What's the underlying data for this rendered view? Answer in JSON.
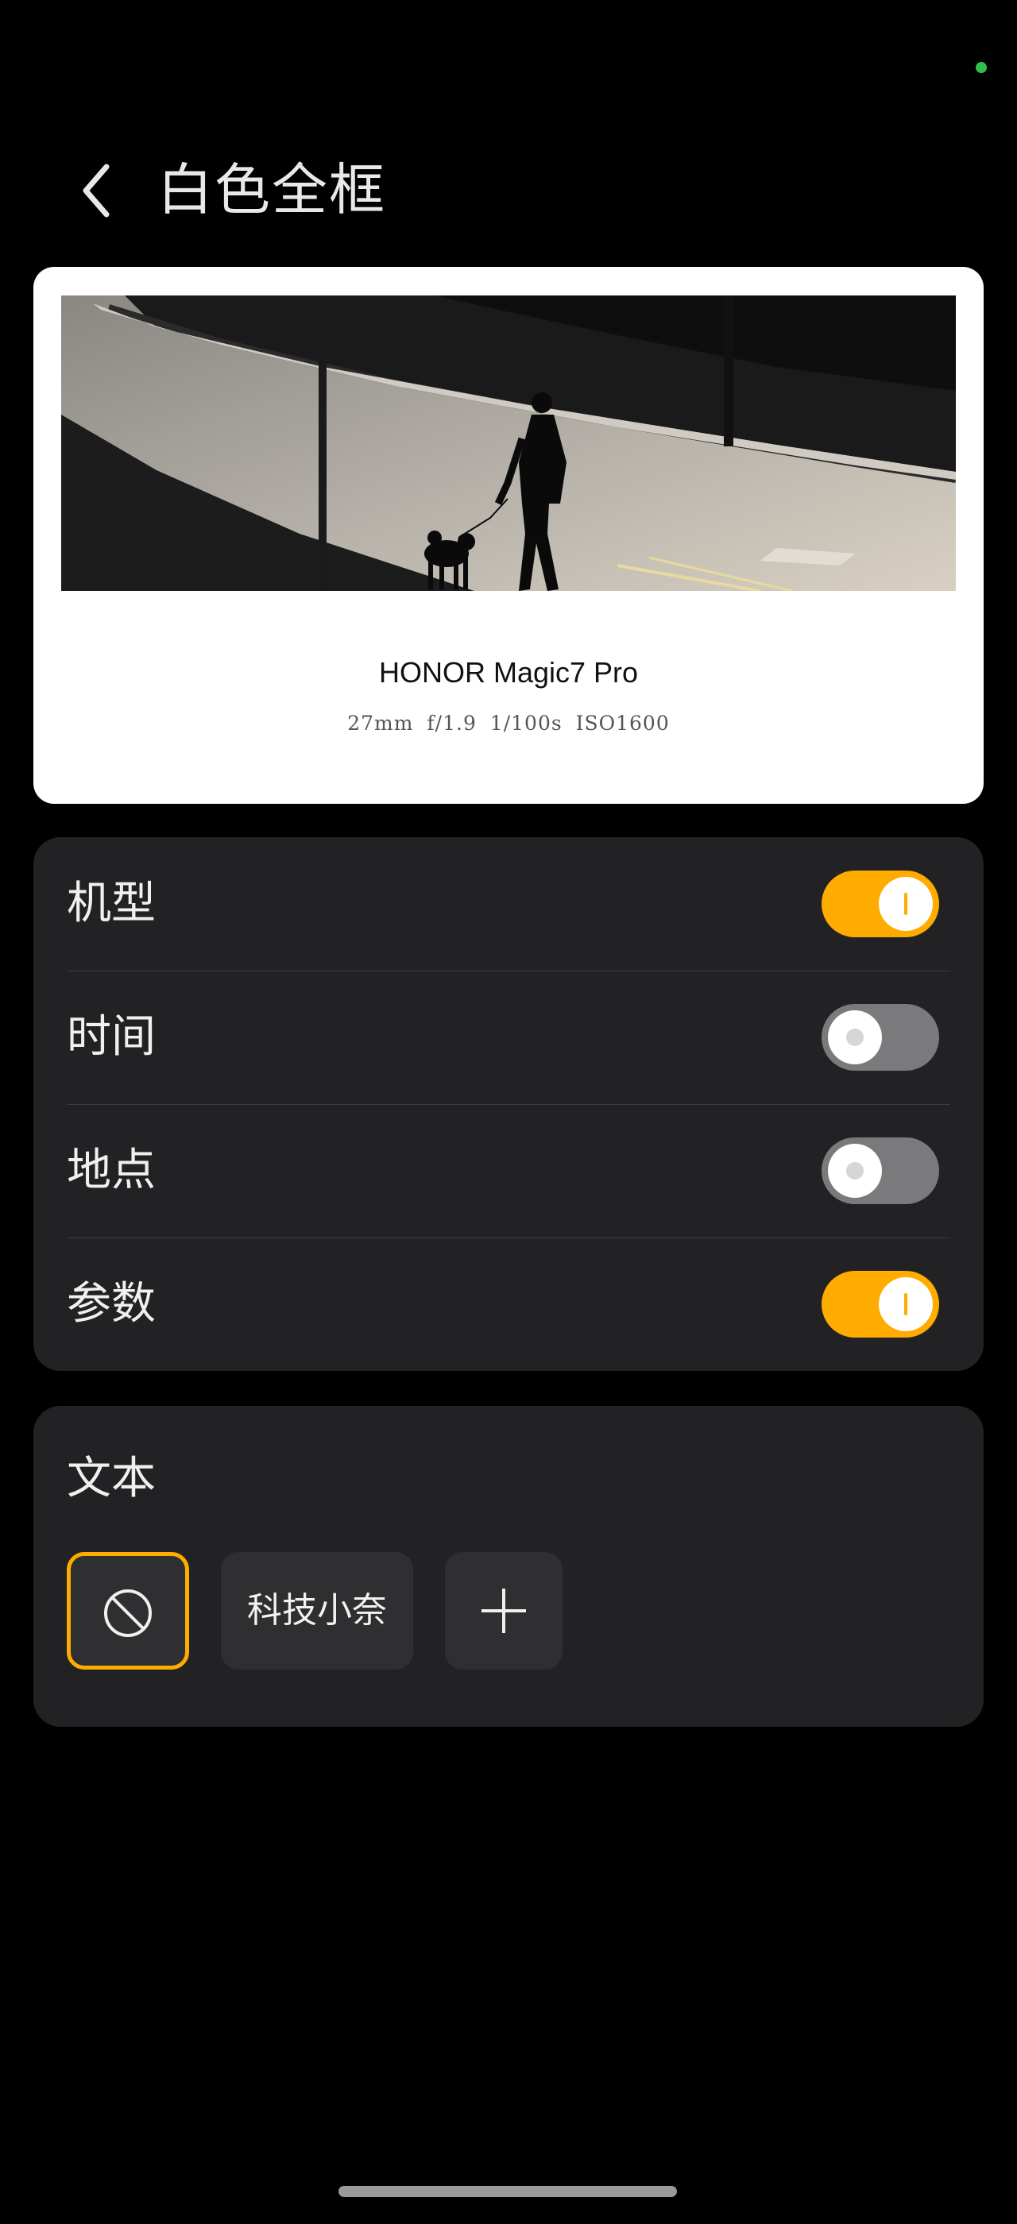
{
  "header": {
    "title": "白色全框"
  },
  "preview": {
    "model_name": "HONOR Magic7 Pro",
    "exif_params": "27mm  f/1.9  1/100s  ISO1600"
  },
  "toggles": [
    {
      "label": "机型",
      "state": "on"
    },
    {
      "label": "时间",
      "state": "off"
    },
    {
      "label": "地点",
      "state": "off"
    },
    {
      "label": "参数",
      "state": "on"
    }
  ],
  "text_section": {
    "title": "文本",
    "options": [
      {
        "type": "none",
        "icon": "no-text-icon",
        "selected": true
      },
      {
        "type": "text",
        "label": "科技小奈",
        "selected": false
      },
      {
        "type": "add",
        "icon": "plus-icon",
        "selected": false
      }
    ]
  },
  "colors": {
    "accent": "#ffab00",
    "card_bg": "#222224",
    "page_bg": "#000000",
    "status_dot": "#2fbf4f"
  }
}
